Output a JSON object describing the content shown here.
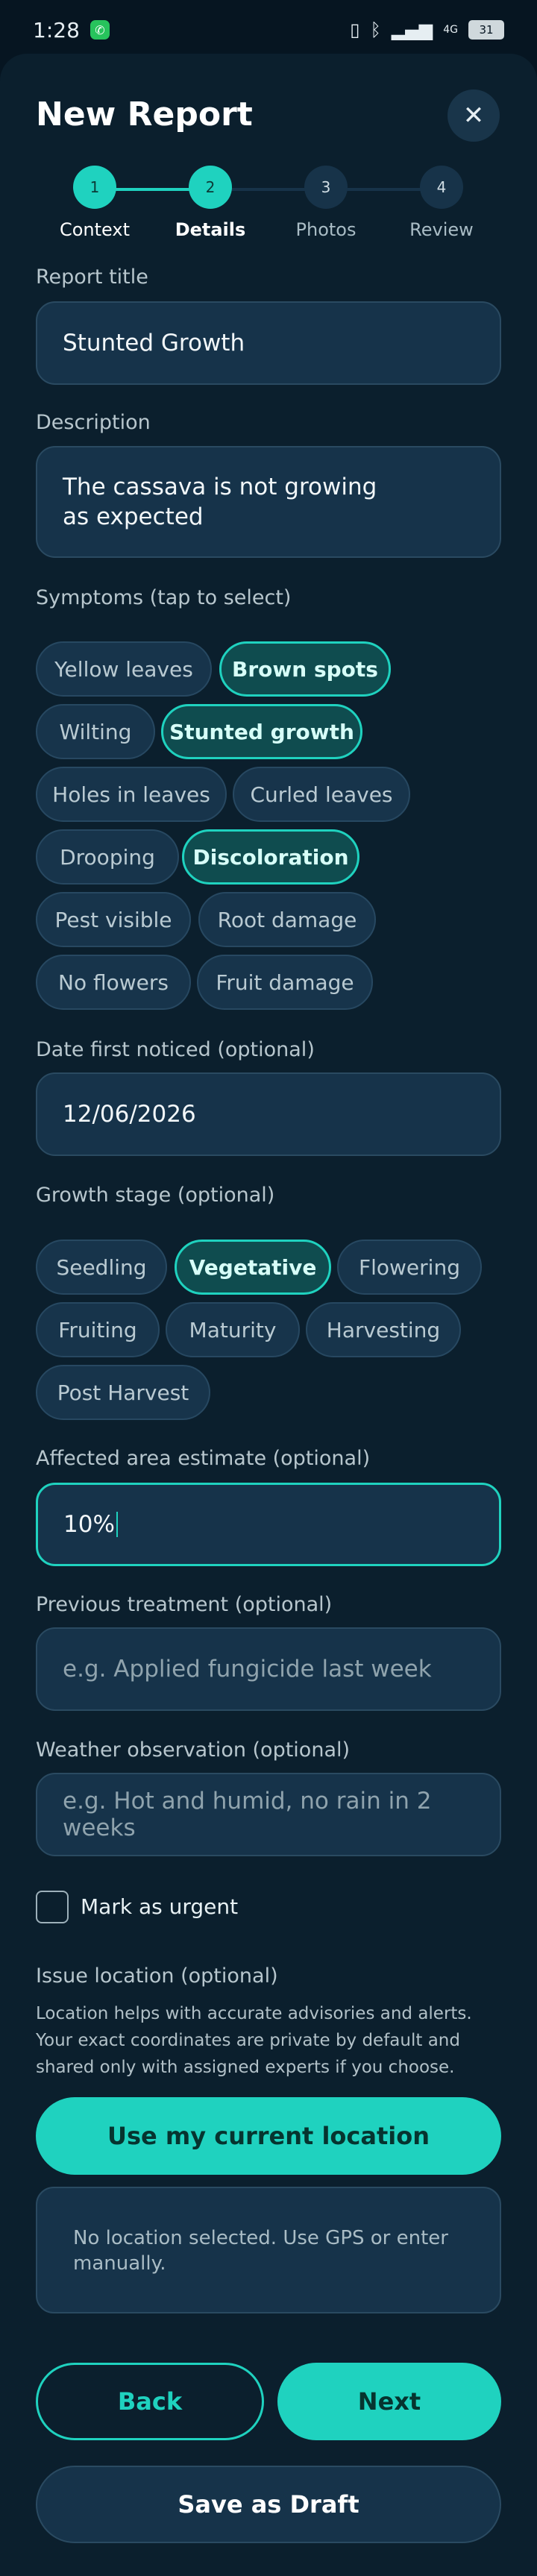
{
  "status": {
    "time": "1:28",
    "battery": "31",
    "network": "4G"
  },
  "header": {
    "title": "New Report",
    "close_icon": "close-icon"
  },
  "steps": [
    {
      "num": "1",
      "label": "Context",
      "state": "done"
    },
    {
      "num": "2",
      "label": "Details",
      "state": "active"
    },
    {
      "num": "3",
      "label": "Photos",
      "state": "todo"
    },
    {
      "num": "4",
      "label": "Review",
      "state": "todo"
    }
  ],
  "form": {
    "report_title_label": "Report title",
    "report_title_value": "Stunted Growth",
    "description_label": "Description",
    "description_value": "The cassava is not growing as expected",
    "symptoms_label": "Symptoms (tap to select)",
    "symptoms": [
      {
        "label": "Yellow leaves",
        "selected": false
      },
      {
        "label": "Brown spots",
        "selected": true
      },
      {
        "label": "Wilting",
        "selected": false
      },
      {
        "label": "Stunted growth",
        "selected": true
      },
      {
        "label": "Holes in leaves",
        "selected": false
      },
      {
        "label": "Curled leaves",
        "selected": false
      },
      {
        "label": "Drooping",
        "selected": false
      },
      {
        "label": "Discoloration",
        "selected": true
      },
      {
        "label": "Pest visible",
        "selected": false
      },
      {
        "label": "Root damage",
        "selected": false
      },
      {
        "label": "No flowers",
        "selected": false
      },
      {
        "label": "Fruit damage",
        "selected": false
      }
    ],
    "date_label": "Date first noticed (optional)",
    "date_value": "12/06/2026",
    "growth_label": "Growth stage (optional)",
    "growth_stages": [
      {
        "label": "Seedling",
        "selected": false
      },
      {
        "label": "Vegetative",
        "selected": true
      },
      {
        "label": "Flowering",
        "selected": false
      },
      {
        "label": "Fruiting",
        "selected": false
      },
      {
        "label": "Maturity",
        "selected": false
      },
      {
        "label": "Harvesting",
        "selected": false
      },
      {
        "label": "Post Harvest",
        "selected": false
      }
    ],
    "area_label": "Affected area estimate (optional)",
    "area_value": "10%",
    "treatment_label": "Previous treatment (optional)",
    "treatment_placeholder": "e.g. Applied fungicide last week",
    "weather_label": "Weather observation (optional)",
    "weather_placeholder": "e.g. Hot and humid, no rain in 2 weeks",
    "urgent_label": "Mark as urgent",
    "urgent_checked": false,
    "location_label": "Issue location (optional)",
    "location_help": "Location helps with accurate advisories and alerts. Your exact coordinates are private by default and shared only with assigned experts if you choose.",
    "location_button": "Use my current location",
    "location_status": "No location selected. Use GPS or enter manually."
  },
  "actions": {
    "back": "Back",
    "next": "Next",
    "draft": "Save as Draft"
  },
  "colors": {
    "accent": "#1fd2bf",
    "background": "#0b1f2d",
    "field": "#16334a"
  }
}
